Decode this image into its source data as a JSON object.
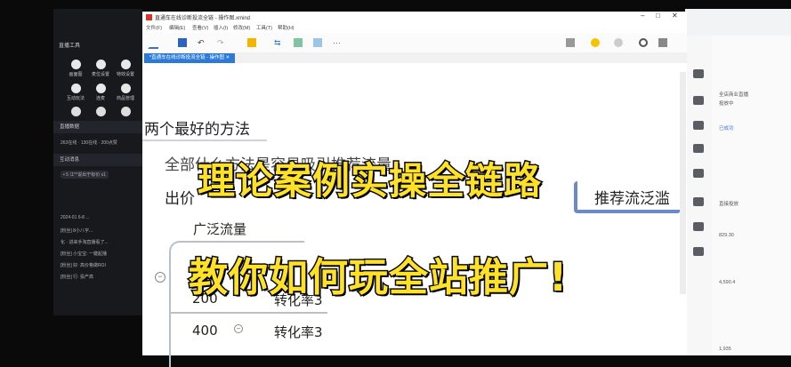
{
  "live_panel": {
    "title": "直播工具",
    "tools_row1": [
      "画面图",
      "麦位设置",
      "特效设置"
    ],
    "tools_row2": [
      "互动玩法",
      "连麦",
      "商品管理"
    ],
    "section_data": "直播数据",
    "stats": "263在线 · 130在线 · 200点赞",
    "section_interact": "互动消息",
    "interact_line": "• 5 江**说出于标价 x1",
    "chat_lines": [
      "2024-01 6-8 ...",
      "[粉丝] 8小八字...",
      "化 · 进来手淘直播看了...",
      "[粉丝] 小宝宝: 一键起播",
      "[粉丝] 好: 高价格做ROI",
      "[粉丝] 行: 投产高"
    ]
  },
  "window": {
    "title": "直通车在线诊断投流全链 - 操作图.xmind",
    "menu": [
      "文件(F)",
      "编辑(E)",
      "查看(V)",
      "插入(I)",
      "修改(M)",
      "工具(T)",
      "帮助(H)"
    ],
    "tab_label": "*直通车在线诊断投流全链 - 操作图"
  },
  "mindmap": {
    "heading": "两个最好的方法",
    "line2": "全部什么方法是容易吸引推荐流量",
    "line3_left": "出价",
    "line3_right": "推荐流泛滥",
    "branch": "广泛流量",
    "row1_num": "200",
    "row1_text": "转化率3",
    "row2_num": "400",
    "row2_text": "转化率3"
  },
  "overlay": {
    "line1": "理论案例实操全链路",
    "line2": "教你如何玩全站推广!"
  },
  "right_panel": {
    "texts": [
      "全店商业直播",
      "投放中",
      "已成功",
      "直接投放",
      "829.30",
      "4,590.4",
      "1,935"
    ]
  }
}
